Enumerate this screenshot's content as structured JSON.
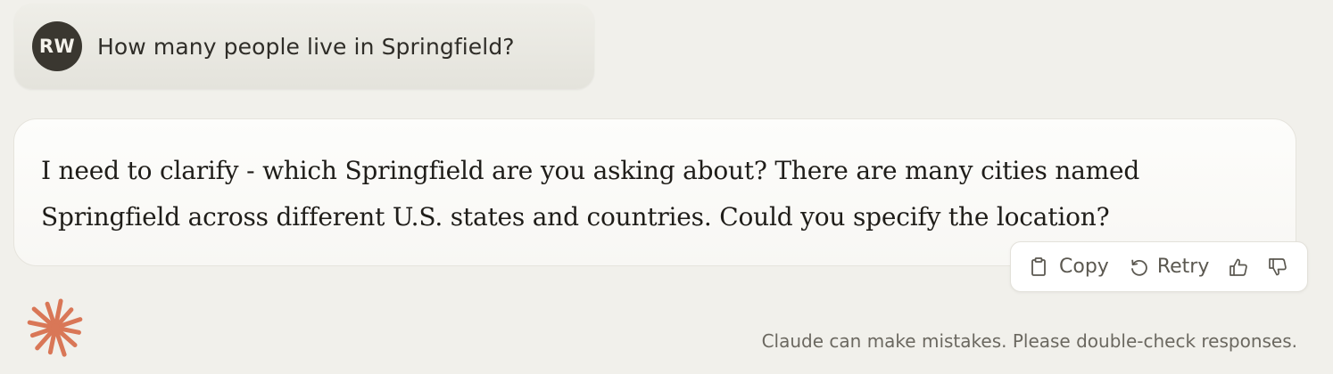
{
  "user": {
    "initials": "RW",
    "message": "How many people live in Springfield?"
  },
  "assistant": {
    "message": "I need to clarify - which Springfield are you asking about? There are many cities named Springfield across different U.S. states and countries. Could you specify the location?"
  },
  "actions": {
    "copy_label": "Copy",
    "retry_label": "Retry",
    "copy_icon": "clipboard-icon",
    "retry_icon": "retry-icon",
    "thumbs_up_icon": "thumbs-up-icon",
    "thumbs_down_icon": "thumbs-down-icon"
  },
  "footer": {
    "disclaimer": "Claude can make mistakes. Please double-check responses.",
    "logo_icon": "claude-logo-icon"
  },
  "colors": {
    "background": "#f1f0eb",
    "avatar": "#3a3730",
    "logo": "#d97757"
  }
}
